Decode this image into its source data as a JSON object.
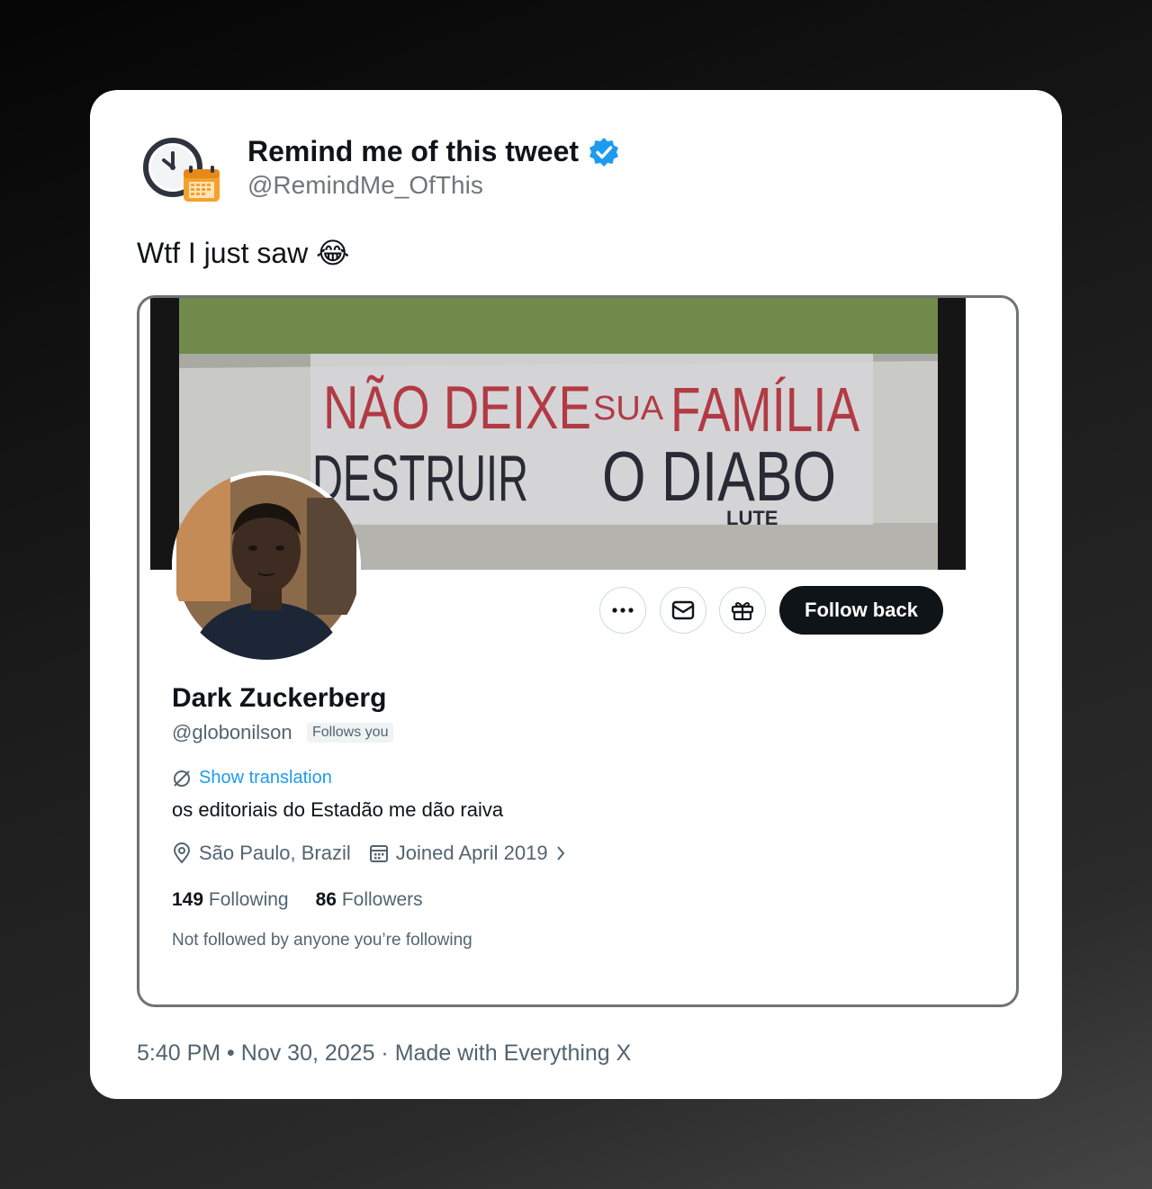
{
  "tweet": {
    "author_name": "Remind me of this tweet",
    "author_handle": "@RemindMe_OfThis",
    "text": "Wtf I just saw 😂",
    "time": "5:40 PM",
    "date": "Nov 30, 2025",
    "made_with": "Made with Everything X"
  },
  "embedded_profile": {
    "banner_text": {
      "line1_a": "NÃO DEIXE",
      "line1_b": "SUA",
      "line1_c": "FAMÍLIA",
      "line2_a": "DESTRUIR",
      "line2_b": "O DIABO",
      "signature": "LUTE"
    },
    "follow_button": "Follow back",
    "name": "Dark Zuckerberg",
    "handle": "@globonilson",
    "follows_you": "Follows you",
    "show_translation": "Show translation",
    "bio": "os editoriais do Estadão me dão raiva",
    "location": "São Paulo, Brazil",
    "joined": "Joined April 2019",
    "following_count": "149",
    "following_label": "Following",
    "followers_count": "86",
    "followers_label": "Followers",
    "not_followed": "Not followed by anyone you’re following"
  },
  "colors": {
    "verified": "#1d9bf0",
    "link": "#1d9bf0",
    "follow_button_bg": "#0f1419"
  }
}
